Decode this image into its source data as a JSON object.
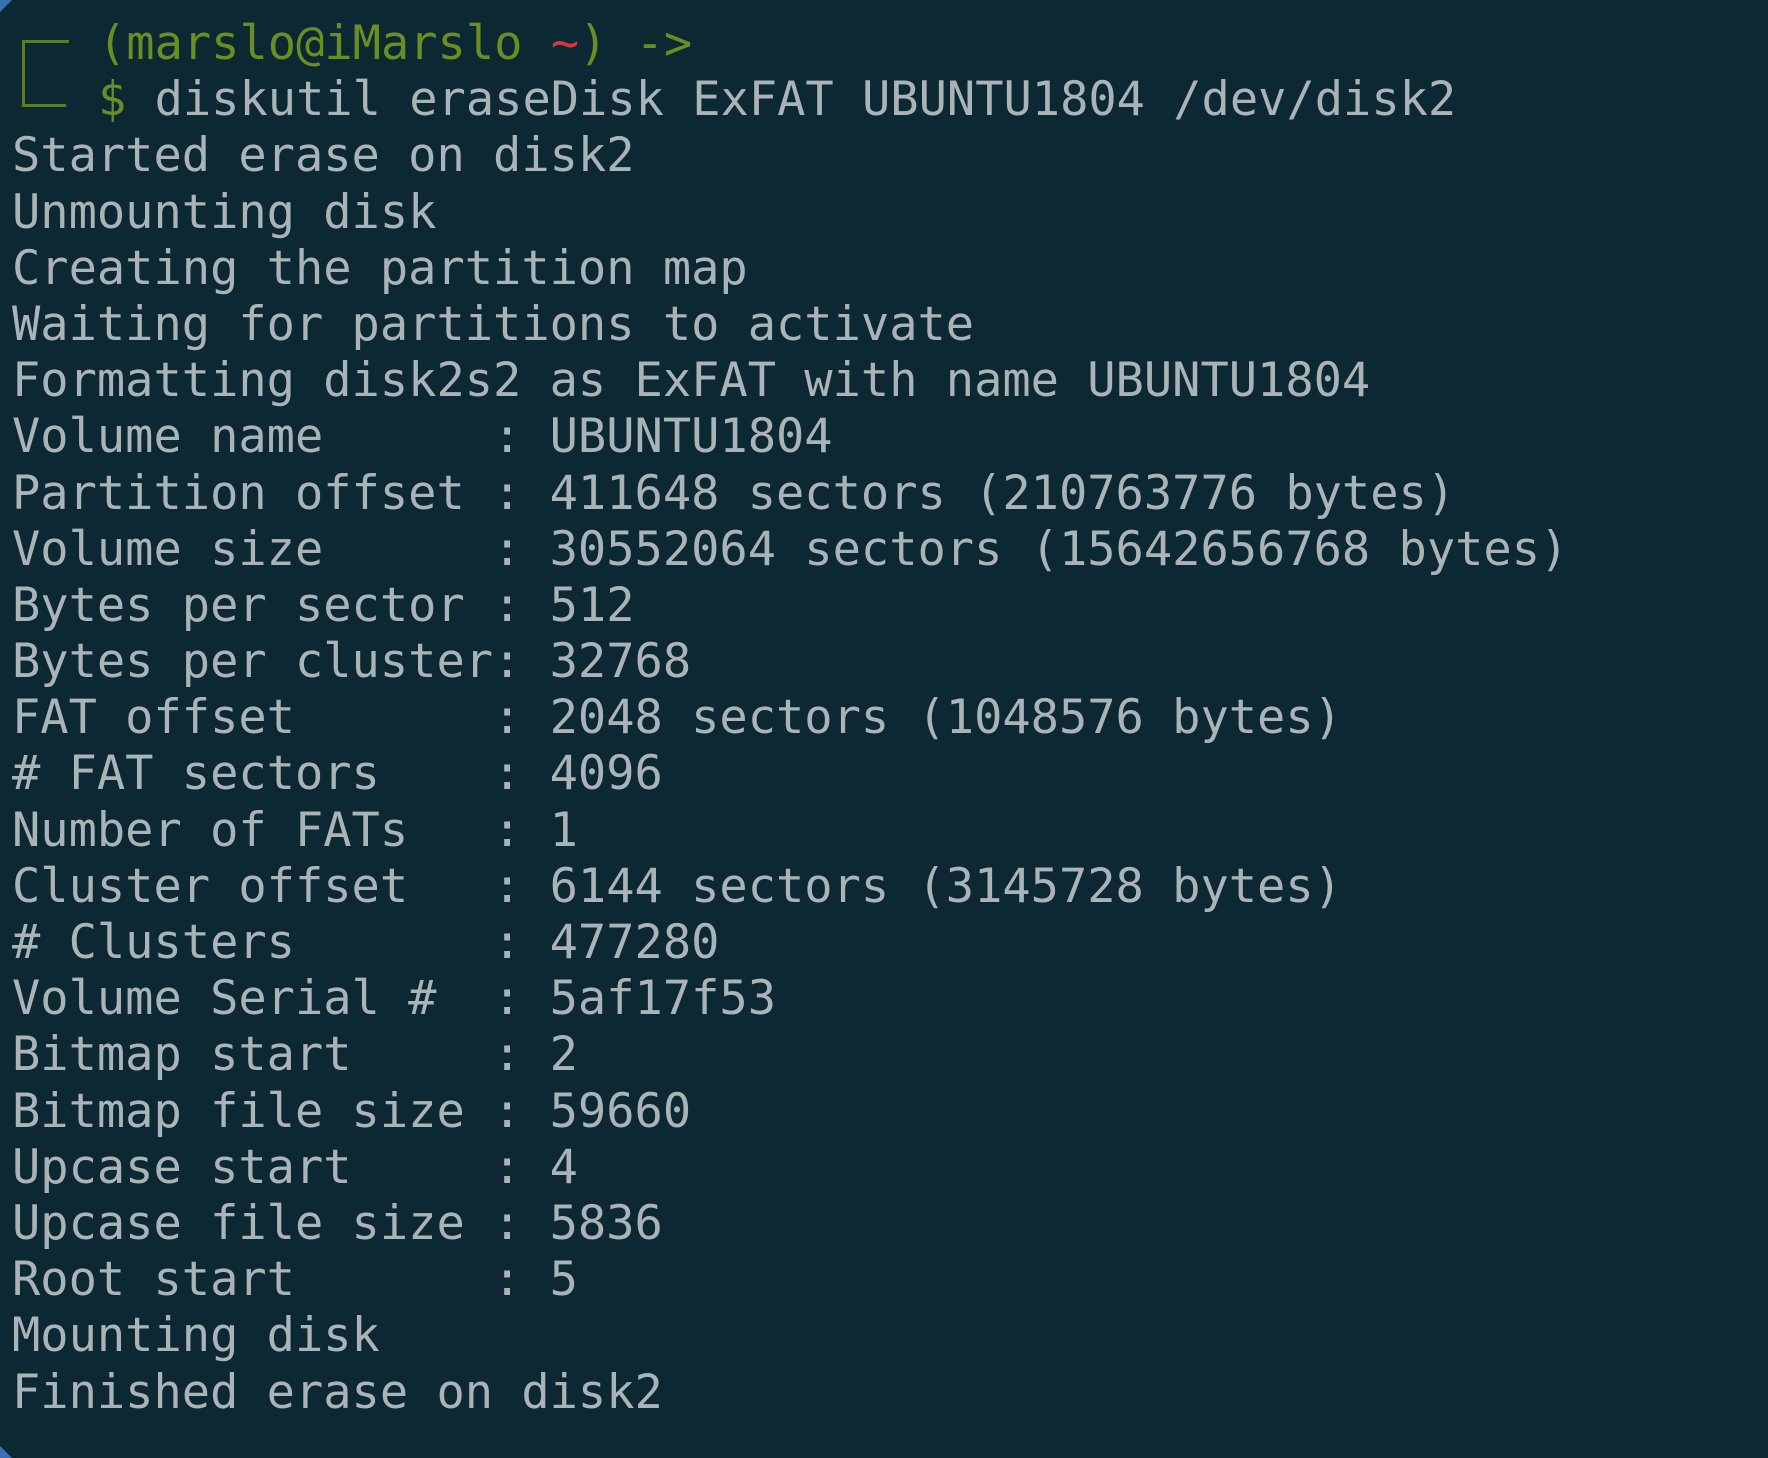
{
  "prompt": {
    "user_host": "(marslo@iMarslo",
    "cwd": "~",
    "arrow": ") ->",
    "dollar": "$",
    "command": "diskutil eraseDisk ExFAT UBUNTU1804 /dev/disk2"
  },
  "colors": {
    "background": "#0c2832",
    "text": "#aab3b6",
    "prompt_green": "#6b8e23",
    "prompt_red": "#d33a3a",
    "edge_accent": "#3b6fb6"
  },
  "output": [
    "Started erase on disk2",
    "Unmounting disk",
    "Creating the partition map",
    "Waiting for partitions to activate",
    "Formatting disk2s2 as ExFAT with name UBUNTU1804",
    "Volume name      : UBUNTU1804",
    "Partition offset : 411648 sectors (210763776 bytes)",
    "Volume size      : 30552064 sectors (15642656768 bytes)",
    "Bytes per sector : 512",
    "Bytes per cluster: 32768",
    "FAT offset       : 2048 sectors (1048576 bytes)",
    "# FAT sectors    : 4096",
    "Number of FATs   : 1",
    "Cluster offset   : 6144 sectors (3145728 bytes)",
    "# Clusters       : 477280",
    "Volume Serial #  : 5af17f53",
    "Bitmap start     : 2",
    "Bitmap file size : 59660",
    "Upcase start     : 4",
    "Upcase file size : 5836",
    "Root start       : 5",
    "Mounting disk",
    "Finished erase on disk2"
  ]
}
